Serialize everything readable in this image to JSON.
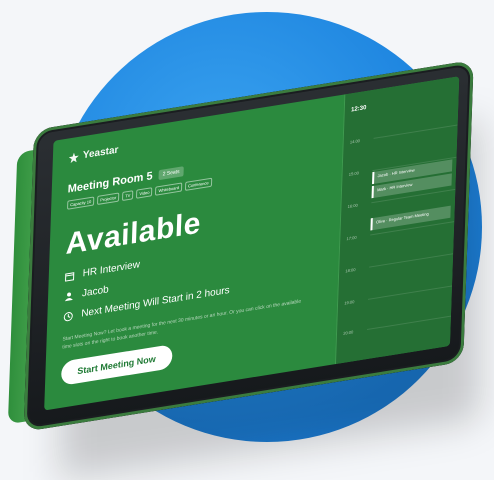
{
  "brand": {
    "name": "Yeastar"
  },
  "room": {
    "name": "Meeting Room 5",
    "badge": "2 Seats",
    "tags": [
      "Capacity 10",
      "Projector",
      "TV",
      "Video",
      "Whiteboard",
      "Conference"
    ]
  },
  "status": {
    "label": "Available"
  },
  "meeting": {
    "title": "HR Interview",
    "organizer": "Jacob",
    "next": "Next Meeting Will Start in 2 hours",
    "notice": "Start Meeting Now? Let book a meeting for the next 30 minutes or an hour. Or you can click on the available time slots on the right to book another time."
  },
  "actions": {
    "start_label": "Start Meeting Now"
  },
  "schedule": {
    "current_time": "12:30",
    "hours": [
      "14:00",
      "15:00",
      "16:00",
      "17:00",
      "18:00",
      "19:00",
      "20:00"
    ],
    "events": [
      {
        "label": "Jacob · HR Interview"
      },
      {
        "label": "Mark · HR Interview"
      },
      {
        "label": "Olive · Regular Team Meeting"
      }
    ]
  },
  "colors": {
    "screen_green": "#2b8a3e",
    "schedule_green": "#256f34",
    "circle_blue": "#1f86e0",
    "button_text": "#1f7a34"
  }
}
